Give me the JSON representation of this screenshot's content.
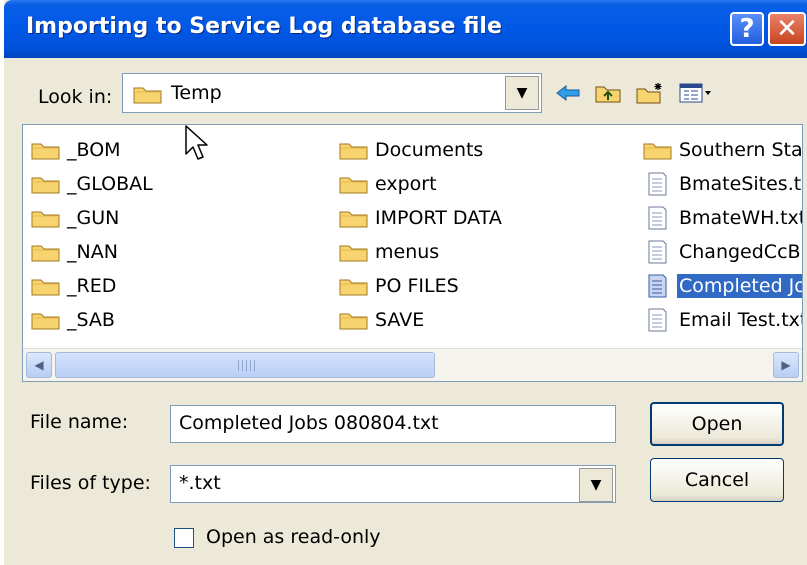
{
  "titlebar": {
    "title": "Importing to Service Log database file",
    "help_glyph": "?",
    "close_glyph": "✕"
  },
  "look_in": {
    "label": "Look in:",
    "value": "Temp",
    "dropdown_glyph": "▼",
    "tools": [
      "back-arrow-icon",
      "up-folder-icon",
      "new-folder-icon",
      "view-menu-icon"
    ]
  },
  "file_list": {
    "columns": [
      {
        "items": [
          {
            "name": "_BOM",
            "type": "folder"
          },
          {
            "name": "_GLOBAL",
            "type": "folder"
          },
          {
            "name": "_GUN",
            "type": "folder"
          },
          {
            "name": "_NAN",
            "type": "folder"
          },
          {
            "name": "_RED",
            "type": "folder"
          },
          {
            "name": "_SAB",
            "type": "folder"
          }
        ]
      },
      {
        "items": [
          {
            "name": "Documents",
            "type": "folder"
          },
          {
            "name": "export",
            "type": "folder"
          },
          {
            "name": "IMPORT DATA",
            "type": "folder"
          },
          {
            "name": "menus",
            "type": "folder"
          },
          {
            "name": "PO FILES",
            "type": "folder"
          },
          {
            "name": "SAVE",
            "type": "folder"
          }
        ]
      },
      {
        "items": [
          {
            "name": "Southern Stat",
            "type": "folder"
          },
          {
            "name": "BmateSites.tx",
            "type": "text"
          },
          {
            "name": "BmateWH.txt",
            "type": "text"
          },
          {
            "name": "ChangedCcBl",
            "type": "text"
          },
          {
            "name": "Completed Jo",
            "type": "text",
            "selected": true
          },
          {
            "name": "Email Test.txt",
            "type": "text"
          }
        ]
      }
    ],
    "scrollbar": {
      "left_glyph": "◀",
      "right_glyph": "▶"
    }
  },
  "file_name": {
    "label": "File name:",
    "value": "Completed Jobs 080804.txt"
  },
  "files_of_type": {
    "label": "Files of type:",
    "value": "*.txt",
    "dropdown_glyph": "▼"
  },
  "buttons": {
    "open": "Open",
    "cancel": "Cancel"
  },
  "read_only": {
    "label": "Open as read-only",
    "checked": false
  },
  "colors": {
    "title_blue": "#0058e6",
    "selection": "#316ac5",
    "dialog_bg": "#ece9d8",
    "folder_yellow": "#f7d470"
  }
}
